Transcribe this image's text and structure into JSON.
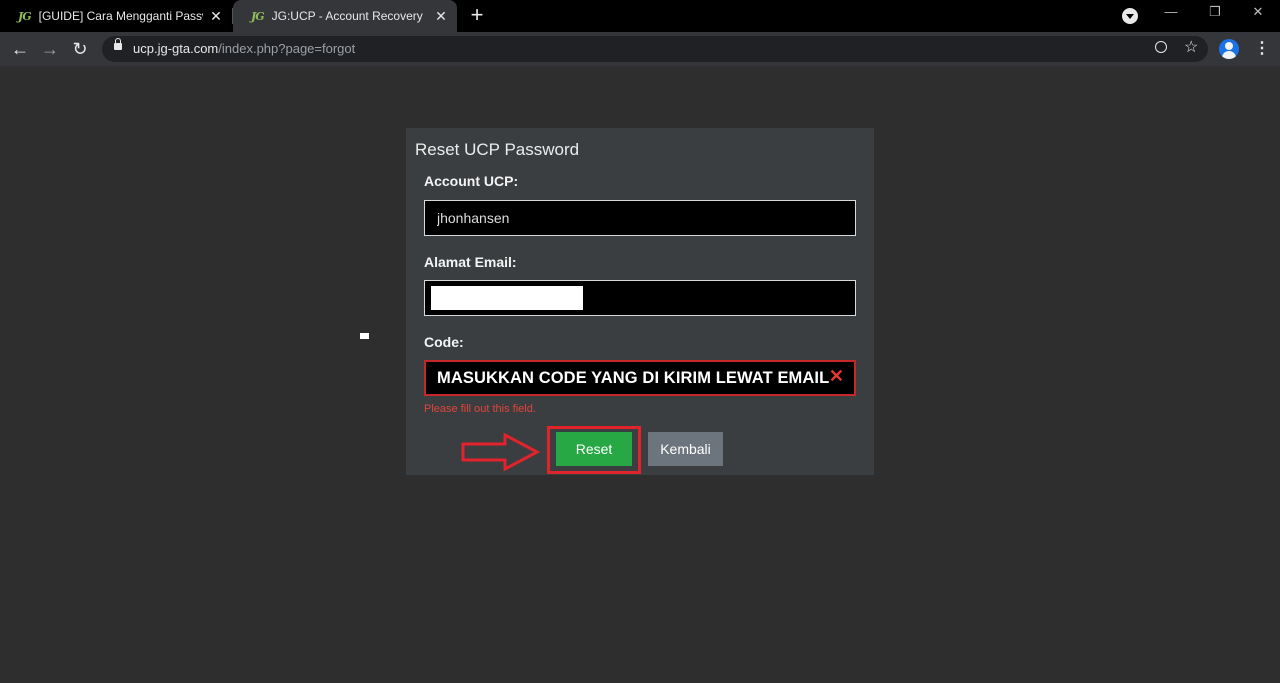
{
  "browser": {
    "tabs": [
      {
        "favicon": "JG",
        "title": "[GUIDE] Cara Mengganti Passwo",
        "active": false
      },
      {
        "favicon": "JG",
        "title": "JG:UCP - Account Recovery",
        "active": true
      }
    ],
    "new_tab": "+",
    "url_host": "ucp.jg-gta.com",
    "url_path": "/index.php?page=forgot"
  },
  "form": {
    "title": "Reset UCP Password",
    "account_label": "Account UCP:",
    "account_value": "jhonhansen",
    "email_label": "Alamat Email:",
    "code_label": "Code:",
    "code_annotation": "MASUKKAN CODE YANG DI KIRIM LEWAT EMAIL",
    "validation_message": "Please fill out this field.",
    "reset_button": "Reset",
    "back_button": "Kembali"
  },
  "colors": {
    "page_bg": "#2e2e2e",
    "panel_bg": "#3b3e41",
    "reset_green": "#28a745",
    "back_gray": "#6c757d",
    "annotation_red": "#e3232b"
  },
  "icons": [
    "tab-favicon-jg",
    "tab-close-icon",
    "new-tab-icon",
    "back-arrow-icon",
    "forward-arrow-icon",
    "reload-icon",
    "lock-icon",
    "zoom-icon",
    "star-icon",
    "profile-avatar",
    "kebab-menu-icon",
    "minimize-icon",
    "restore-icon",
    "window-close-icon",
    "tab-search-icon",
    "clear-x-icon",
    "annotation-arrow"
  ]
}
